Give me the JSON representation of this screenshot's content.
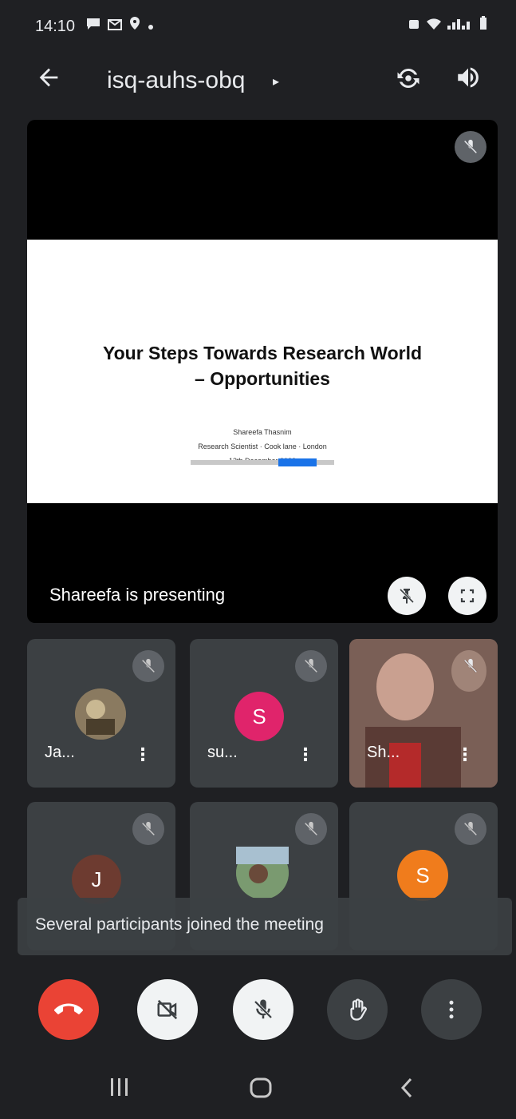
{
  "status_bar": {
    "time": "14:10",
    "left_icons": [
      "chat-icon",
      "mail-icon",
      "location-icon",
      "dot"
    ],
    "right_icons": [
      "alarm-icon",
      "wifi-icon",
      "signal-icon",
      "battery-icon"
    ]
  },
  "header": {
    "meeting_code": "isq-auhs-obq",
    "caret": "▸"
  },
  "presentation": {
    "slide_title_line1": "Your Steps Towards Research World",
    "slide_title_line2": "– Opportunities",
    "slide_line1": "Shareefa Thasnim",
    "slide_line2": "Research Scientist · Cook lane · London",
    "slide_line3": "13th December 2022",
    "presenter_label": "Shareefa is presenting"
  },
  "participants": [
    {
      "name": "Ja...",
      "initial": "",
      "avatar": "photo",
      "avatar_color": "#6b5a43"
    },
    {
      "name": "su...",
      "initial": "S",
      "avatar": "initial",
      "avatar_color": "#e0246b"
    },
    {
      "name": "Sh...",
      "initial": "",
      "avatar": "video",
      "avatar_color": "#7a5f56"
    },
    {
      "name": "",
      "initial": "J",
      "avatar": "initial",
      "avatar_color": "#6d3b30"
    },
    {
      "name": "",
      "initial": "",
      "avatar": "photo",
      "avatar_color": "#5c7a55"
    },
    {
      "name": "",
      "initial": "S",
      "avatar": "initial",
      "avatar_color": "#f07c1c"
    }
  ],
  "toast": "Several participants joined the meeting",
  "controls": {
    "colors": {
      "end_call": "#ea4335",
      "light": "#f1f3f4",
      "dark": "#3c4043"
    }
  }
}
